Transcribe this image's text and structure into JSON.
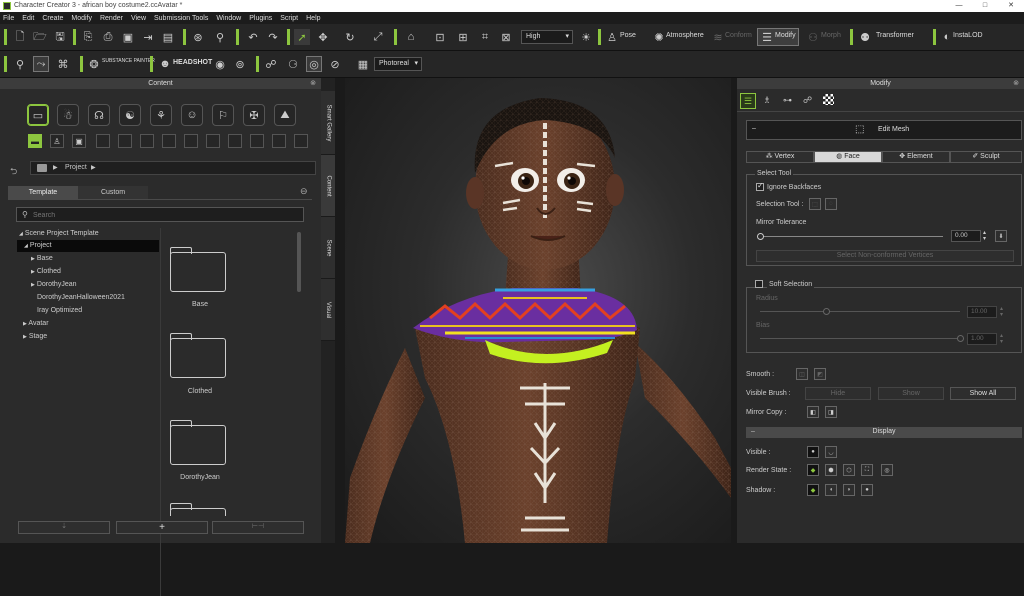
{
  "window": {
    "title": "Character Creator 3 - african boy costume2.ccAvatar *",
    "minimize": "—",
    "maximize": "□",
    "close": "✕"
  },
  "menu": [
    "File",
    "Edit",
    "Create",
    "Modify",
    "Render",
    "View",
    "Submission Tools",
    "Window",
    "Plugins",
    "Script",
    "Help"
  ],
  "toolbar1": {
    "quality": "High",
    "pose": "Pose",
    "atmosphere": "Atmosphere",
    "conform": "Conform",
    "modify": "Modify",
    "morph": "Morph",
    "transformer": "Transformer",
    "instalod": "InstaLOD"
  },
  "toolbar2": {
    "substance": "SUBSTANCE PAINTER",
    "headshot": "HEADSHOT",
    "render_mode": "Photoreal"
  },
  "content": {
    "title": "Content",
    "breadcrumb": "Project",
    "tabs": [
      "Template",
      "Custom"
    ],
    "search_placeholder": "Search",
    "tree": [
      {
        "label": "Scene Project Template",
        "arrow": "◢"
      },
      {
        "label": "Project",
        "arrow": "◢"
      },
      {
        "label": "Base",
        "arrow": "▶"
      },
      {
        "label": "Clothed",
        "arrow": "▶"
      },
      {
        "label": "DorothyJean",
        "arrow": "▶"
      },
      {
        "label": "DorothyJeanHalloween2021",
        "arrow": ""
      },
      {
        "label": "Iray Optimized",
        "arrow": ""
      },
      {
        "label": "Avatar",
        "arrow": "▶"
      },
      {
        "label": "Stage",
        "arrow": "▶"
      }
    ],
    "folders": [
      "Base",
      "Clothed",
      "DorothyJean"
    ],
    "bottom_buttons": [
      "⇣",
      "+",
      "⊢⊣"
    ]
  },
  "side_tabs": [
    "Smart Gallery",
    "Content",
    "Scene",
    "Visual"
  ],
  "modify": {
    "title": "Modify",
    "edit_mesh": "Edit Mesh",
    "mesh_tabs": [
      {
        "label": "Vertex",
        "icon": "⁂"
      },
      {
        "label": "Face",
        "icon": "◍"
      },
      {
        "label": "Element",
        "icon": "✥"
      },
      {
        "label": "Sculpt",
        "icon": "✐"
      }
    ],
    "select_tool": {
      "title": "Select Tool",
      "ignore_backfaces": "Ignore Backfaces",
      "selection_tool": "Selection Tool :",
      "mirror_tolerance": "Mirror Tolerance",
      "mirror_value": "0.00",
      "mirror_level": 0.0,
      "select_conformed": "Select Non-conformed Vertices"
    },
    "soft_selection": {
      "title": "Soft Selection",
      "radius": "Radius",
      "radius_value": "10.00",
      "radius_level": 0.5,
      "bias": "Bias",
      "bias_value": "1.00",
      "bias_level": 1.0
    },
    "smooth": "Smooth :",
    "visible_brush": "Visible Brush :",
    "brush_buttons": [
      "Hide",
      "Show",
      "Show All"
    ],
    "mirror_copy": "Mirror Copy :",
    "display": {
      "title": "Display",
      "visible": "Visible :",
      "render_state": "Render State :",
      "shadow": "Shadow :"
    }
  }
}
